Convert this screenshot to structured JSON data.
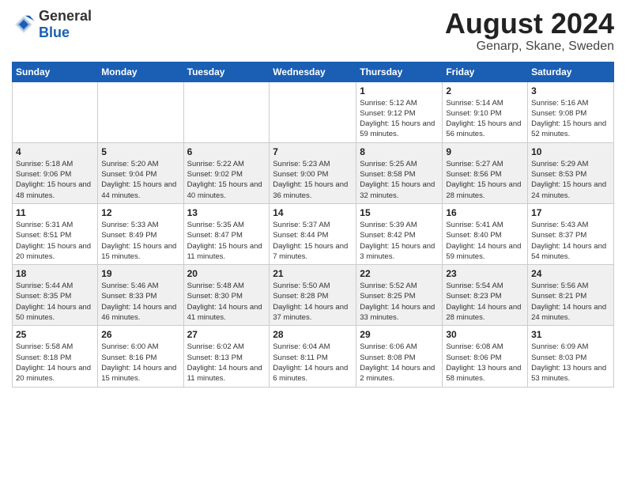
{
  "header": {
    "logo_general": "General",
    "logo_blue": "Blue",
    "title": "August 2024",
    "subtitle": "Genarp, Skane, Sweden"
  },
  "calendar": {
    "days_of_week": [
      "Sunday",
      "Monday",
      "Tuesday",
      "Wednesday",
      "Thursday",
      "Friday",
      "Saturday"
    ],
    "weeks": [
      [
        {
          "day": "",
          "info": ""
        },
        {
          "day": "",
          "info": ""
        },
        {
          "day": "",
          "info": ""
        },
        {
          "day": "",
          "info": ""
        },
        {
          "day": "1",
          "info": "Sunrise: 5:12 AM\nSunset: 9:12 PM\nDaylight: 15 hours\nand 59 minutes."
        },
        {
          "day": "2",
          "info": "Sunrise: 5:14 AM\nSunset: 9:10 PM\nDaylight: 15 hours\nand 56 minutes."
        },
        {
          "day": "3",
          "info": "Sunrise: 5:16 AM\nSunset: 9:08 PM\nDaylight: 15 hours\nand 52 minutes."
        }
      ],
      [
        {
          "day": "4",
          "info": "Sunrise: 5:18 AM\nSunset: 9:06 PM\nDaylight: 15 hours\nand 48 minutes."
        },
        {
          "day": "5",
          "info": "Sunrise: 5:20 AM\nSunset: 9:04 PM\nDaylight: 15 hours\nand 44 minutes."
        },
        {
          "day": "6",
          "info": "Sunrise: 5:22 AM\nSunset: 9:02 PM\nDaylight: 15 hours\nand 40 minutes."
        },
        {
          "day": "7",
          "info": "Sunrise: 5:23 AM\nSunset: 9:00 PM\nDaylight: 15 hours\nand 36 minutes."
        },
        {
          "day": "8",
          "info": "Sunrise: 5:25 AM\nSunset: 8:58 PM\nDaylight: 15 hours\nand 32 minutes."
        },
        {
          "day": "9",
          "info": "Sunrise: 5:27 AM\nSunset: 8:56 PM\nDaylight: 15 hours\nand 28 minutes."
        },
        {
          "day": "10",
          "info": "Sunrise: 5:29 AM\nSunset: 8:53 PM\nDaylight: 15 hours\nand 24 minutes."
        }
      ],
      [
        {
          "day": "11",
          "info": "Sunrise: 5:31 AM\nSunset: 8:51 PM\nDaylight: 15 hours\nand 20 minutes."
        },
        {
          "day": "12",
          "info": "Sunrise: 5:33 AM\nSunset: 8:49 PM\nDaylight: 15 hours\nand 15 minutes."
        },
        {
          "day": "13",
          "info": "Sunrise: 5:35 AM\nSunset: 8:47 PM\nDaylight: 15 hours\nand 11 minutes."
        },
        {
          "day": "14",
          "info": "Sunrise: 5:37 AM\nSunset: 8:44 PM\nDaylight: 15 hours\nand 7 minutes."
        },
        {
          "day": "15",
          "info": "Sunrise: 5:39 AM\nSunset: 8:42 PM\nDaylight: 15 hours\nand 3 minutes."
        },
        {
          "day": "16",
          "info": "Sunrise: 5:41 AM\nSunset: 8:40 PM\nDaylight: 14 hours\nand 59 minutes."
        },
        {
          "day": "17",
          "info": "Sunrise: 5:43 AM\nSunset: 8:37 PM\nDaylight: 14 hours\nand 54 minutes."
        }
      ],
      [
        {
          "day": "18",
          "info": "Sunrise: 5:44 AM\nSunset: 8:35 PM\nDaylight: 14 hours\nand 50 minutes."
        },
        {
          "day": "19",
          "info": "Sunrise: 5:46 AM\nSunset: 8:33 PM\nDaylight: 14 hours\nand 46 minutes."
        },
        {
          "day": "20",
          "info": "Sunrise: 5:48 AM\nSunset: 8:30 PM\nDaylight: 14 hours\nand 41 minutes."
        },
        {
          "day": "21",
          "info": "Sunrise: 5:50 AM\nSunset: 8:28 PM\nDaylight: 14 hours\nand 37 minutes."
        },
        {
          "day": "22",
          "info": "Sunrise: 5:52 AM\nSunset: 8:25 PM\nDaylight: 14 hours\nand 33 minutes."
        },
        {
          "day": "23",
          "info": "Sunrise: 5:54 AM\nSunset: 8:23 PM\nDaylight: 14 hours\nand 28 minutes."
        },
        {
          "day": "24",
          "info": "Sunrise: 5:56 AM\nSunset: 8:21 PM\nDaylight: 14 hours\nand 24 minutes."
        }
      ],
      [
        {
          "day": "25",
          "info": "Sunrise: 5:58 AM\nSunset: 8:18 PM\nDaylight: 14 hours\nand 20 minutes."
        },
        {
          "day": "26",
          "info": "Sunrise: 6:00 AM\nSunset: 8:16 PM\nDaylight: 14 hours\nand 15 minutes."
        },
        {
          "day": "27",
          "info": "Sunrise: 6:02 AM\nSunset: 8:13 PM\nDaylight: 14 hours\nand 11 minutes."
        },
        {
          "day": "28",
          "info": "Sunrise: 6:04 AM\nSunset: 8:11 PM\nDaylight: 14 hours\nand 6 minutes."
        },
        {
          "day": "29",
          "info": "Sunrise: 6:06 AM\nSunset: 8:08 PM\nDaylight: 14 hours\nand 2 minutes."
        },
        {
          "day": "30",
          "info": "Sunrise: 6:08 AM\nSunset: 8:06 PM\nDaylight: 13 hours\nand 58 minutes."
        },
        {
          "day": "31",
          "info": "Sunrise: 6:09 AM\nSunset: 8:03 PM\nDaylight: 13 hours\nand 53 minutes."
        }
      ]
    ]
  }
}
